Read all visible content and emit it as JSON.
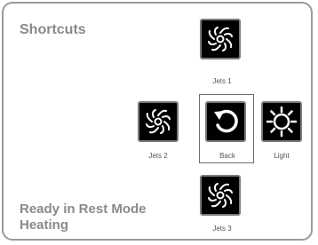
{
  "title": "Shortcuts",
  "buttons": {
    "jets1": {
      "label": "Jets 1",
      "icon": "jets-icon"
    },
    "jets2": {
      "label": "Jets 2",
      "icon": "jets-icon"
    },
    "back": {
      "label": "Back",
      "icon": "back-arrow-icon"
    },
    "light": {
      "label": "Light",
      "icon": "light-sun-icon"
    },
    "jets3": {
      "label": "Jets 3",
      "icon": "jets-icon"
    }
  },
  "status": {
    "line1": "Ready in Rest Mode",
    "line2": "Heating"
  },
  "colors": {
    "tile_bg": "#000000",
    "icon": "#ffffff",
    "text": "#8a8a8a",
    "border": "#9a9a9a"
  }
}
